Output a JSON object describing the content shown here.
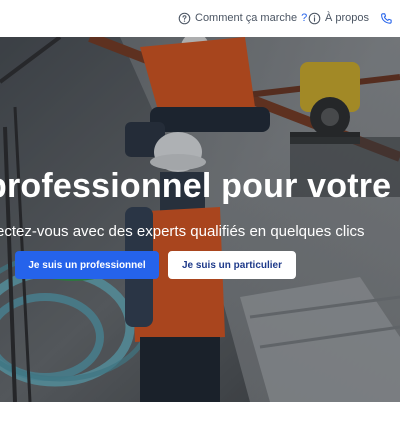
{
  "nav": {
    "how_it_works": "Comment ça marche",
    "how_it_works_q": "?",
    "about": "À propos",
    "contact_icon": "phone-icon"
  },
  "hero": {
    "title": "professionnel pour votre",
    "subtitle": "ectez-vous avec des experts qualifiés en quelques clics",
    "btn_pro": "Je suis un professionnel",
    "btn_part": "Je suis un particulier"
  },
  "colors": {
    "primary": "#2563eb",
    "nav_text": "#4b5563",
    "hero_text": "#ffffff"
  }
}
